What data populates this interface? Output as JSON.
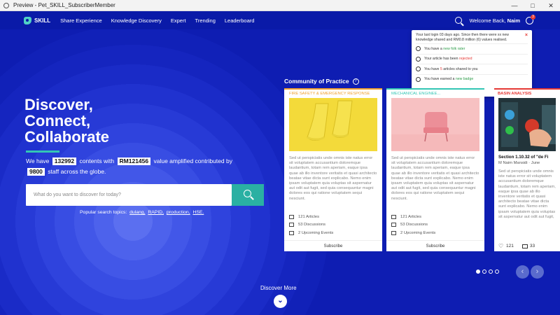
{
  "window": {
    "title": "Preview - Pet_SKILL_SubscriberMember",
    "minimize": "—",
    "maximize": "□",
    "close": "✕"
  },
  "nav": {
    "brand": "SKILL",
    "items": [
      "Share Experience",
      "Knowledge Discovery",
      "Expert",
      "Trending",
      "Leaderboard"
    ],
    "welcome_prefix": "Welcome Back,",
    "user_name": "Naim",
    "notification_count": "3"
  },
  "notifications": {
    "intro": "Your last login 03 days ago. Since then there were xx new knowledge shared and RM0.8 million (6) values realised.",
    "items": [
      {
        "prefix": "You have a",
        "highlight": "new folk rater",
        "suffix": ""
      },
      {
        "prefix": "Your article has been",
        "highlight": "rejected",
        "suffix": ""
      },
      {
        "prefix": "You have",
        "highlight": "5",
        "suffix": "articles shared to you"
      },
      {
        "prefix": "You have earned a",
        "highlight": "new badge",
        "suffix": ""
      }
    ],
    "close": "×"
  },
  "hero": {
    "line1": "Discover,",
    "line2": "Connect,",
    "line3": "Collaborate",
    "we_have": "We have",
    "contents_count": "132992",
    "contents_with": "contents with",
    "value": "RM121456",
    "value_text": "value amplified  contributed by",
    "staff_count": "9800",
    "staff_text": "staff across the globe.",
    "search_placeholder": "What do you want to discover for today?",
    "popular_label": "Popular search topics:",
    "popular_tags": [
      "dulang,",
      "RAPID,",
      "production,",
      "HSE."
    ]
  },
  "community": {
    "title": "Community of Practice",
    "help": "?",
    "cards": [
      {
        "category": "FIRE SAFETY & EMERGENCY RESPONSE",
        "accent": "#f0a030",
        "description": "Sed ut perspiciatis unde omnis iste natus error sit voluptatem accusantium doloremque laudantium, totam rem aperiam, eaque ipsa quae ab illo inventore veritatis et quasi architecto beatae vitae dicta sunt explicabo. Nemo enim ipsam voluptatem quia voluptas sit aspernatur aut odit aut fugit, sed quia consequuntur magni dolores eos qui ratione voluptatem sequi nesciunt.",
        "articles": "121 Articles",
        "discussions": "53 Discussions",
        "events": "2 Upcoming Events",
        "subscribe": "Subscribe"
      },
      {
        "category": "MECHANICAL ENGINEE...",
        "accent": "#33c6b4",
        "description": "Sed ut perspiciatis unde omnis iste natus error sit voluptatem accusantium doloremque laudantium, totam rem aperiam, eaque ipsa quae ab illo inventore veritatis et quasi architecto beatae vitae dicta sunt explicabo. Nemo enim ipsam voluptatem quia voluptas sit aspernatur aut odit aut fugit, sed quia consequuntur magni dolores eos qui ratione voluptatem sequi nesciunt.",
        "articles": "121 Articles",
        "discussions": "53 Discussions",
        "events": "2 Upcoming Events",
        "subscribe": "Subscribe"
      }
    ],
    "article_card": {
      "category": "BASIN ANALYSIS",
      "title": "Section 1.10.32 of \"de Fi",
      "author": "M Naim Mansidi · June",
      "description": "Sed ut perspiciatis unde omnis iste natus error sit voluptatem accusantium doloremque laudantium, totam rem aperiam, eaque ipsa quae ab illo inventore veritatis et quasi architecto beatae vitae dicta sunt explicabo. Nemo enim ipsam voluptatem quia voluptas sit aspernatur aut odit aut fugit, sed quia consequuntur magni dolores eos qui ratione voluptatem sequi nesciunt.",
      "likes": "121",
      "comments": "33"
    },
    "carousel_prev": "‹",
    "carousel_next": "›",
    "active_page": 1,
    "page_count": 4
  },
  "discover_more": {
    "label": "Discover More",
    "icon": "⌄"
  }
}
